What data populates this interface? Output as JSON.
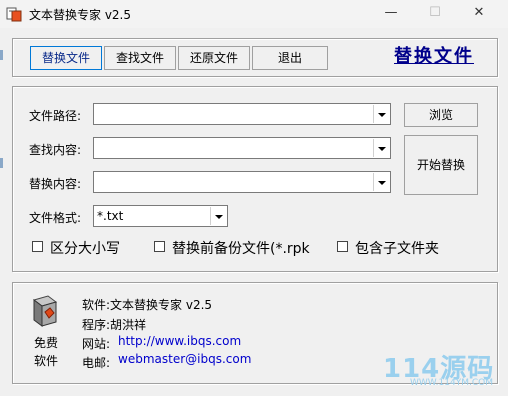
{
  "window": {
    "title": "文本替换专家 v2.5",
    "controls": {
      "minimize": "—",
      "maximize": "☐",
      "close": "✕"
    }
  },
  "toolbar": {
    "buttons": [
      "替换文件",
      "查找文件",
      "还原文件",
      "退出"
    ],
    "active_index": 0,
    "heading": "替换文件"
  },
  "form": {
    "path_label": "文件路径:",
    "path_value": "",
    "find_label": "查找内容:",
    "find_value": "",
    "replace_label": "替换内容:",
    "replace_value": "",
    "format_label": "文件格式:",
    "format_value": "*.txt",
    "browse_label": "浏览",
    "start_label": "开始替换"
  },
  "options": [
    {
      "label": "区分大小写",
      "checked": false
    },
    {
      "label": "替换前备份文件(*.rpk",
      "checked": false
    },
    {
      "label": "包含子文件夹",
      "checked": false
    }
  ],
  "info": {
    "free_line1": "免费",
    "free_line2": "软件",
    "software": "软件:文本替换专家 v2.5",
    "author": "程序:胡洪祥",
    "site_label": "网站:",
    "site_value": "http://www.ibqs.com",
    "email_label": "电邮:",
    "email_value": "webmaster@ibqs.com"
  },
  "watermark": {
    "main": "114源码",
    "sub": "WWW.114YM.COM"
  },
  "colors": {
    "heading": "#00008b",
    "link": "#0000cc",
    "watermark": "#9ad0ee"
  }
}
